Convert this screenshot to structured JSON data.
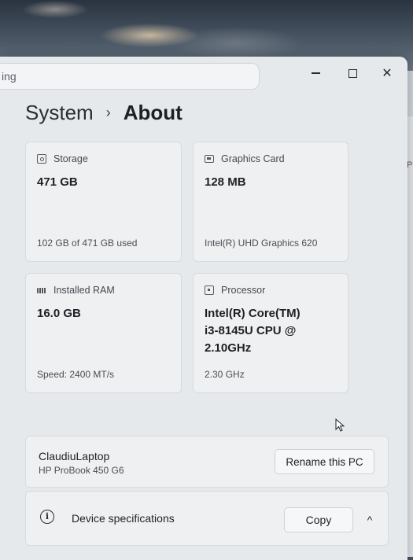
{
  "search": {
    "value": "ing"
  },
  "window_controls": {
    "minimize": "minimize",
    "maximize": "maximize",
    "close": "close",
    "close_glyph": "✕"
  },
  "breadcrumb": {
    "parent": "System",
    "separator": "›",
    "current": "About"
  },
  "specs": {
    "storage": {
      "label": "Storage",
      "value": "471 GB",
      "detail": "102 GB of 471 GB used",
      "icon": "storage-icon"
    },
    "graphics": {
      "label": "Graphics Card",
      "value": "128 MB",
      "detail": "Intel(R) UHD Graphics 620",
      "icon": "graphics-card-icon"
    },
    "ram": {
      "label": "Installed RAM",
      "value": "16.0 GB",
      "detail": "Speed: 2400 MT/s",
      "icon": "ram-icon"
    },
    "processor": {
      "label": "Processor",
      "value_lines": [
        "Intel(R) Core(TM)",
        "i3-8145U CPU @",
        "2.10GHz"
      ],
      "detail": "2.30 GHz",
      "icon": "processor-icon"
    }
  },
  "device": {
    "name": "ClaudiuLaptop",
    "model": "HP ProBook 450 G6",
    "rename_label": "Rename this PC"
  },
  "device_specifications": {
    "title": "Device specifications",
    "copy_label": "Copy",
    "info_glyph": "i",
    "collapse_glyph": "^"
  },
  "background_window": {
    "text": "P"
  }
}
